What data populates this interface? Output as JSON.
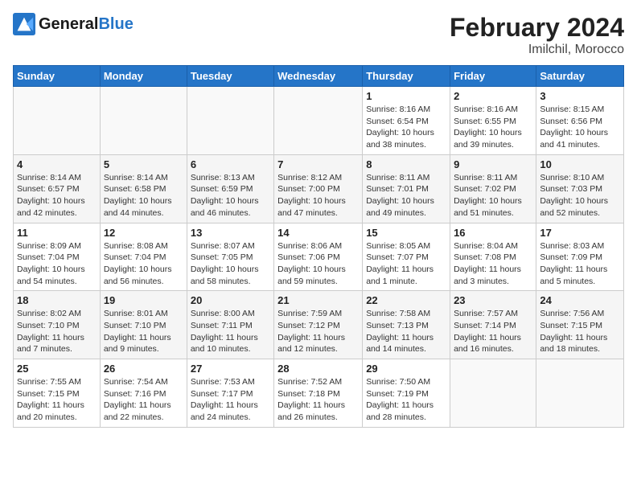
{
  "header": {
    "logo_general": "General",
    "logo_blue": "Blue",
    "month_year": "February 2024",
    "location": "Imilchil, Morocco"
  },
  "weekdays": [
    "Sunday",
    "Monday",
    "Tuesday",
    "Wednesday",
    "Thursday",
    "Friday",
    "Saturday"
  ],
  "weeks": [
    [
      {
        "day": "",
        "info": ""
      },
      {
        "day": "",
        "info": ""
      },
      {
        "day": "",
        "info": ""
      },
      {
        "day": "",
        "info": ""
      },
      {
        "day": "1",
        "info": "Sunrise: 8:16 AM\nSunset: 6:54 PM\nDaylight: 10 hours\nand 38 minutes."
      },
      {
        "day": "2",
        "info": "Sunrise: 8:16 AM\nSunset: 6:55 PM\nDaylight: 10 hours\nand 39 minutes."
      },
      {
        "day": "3",
        "info": "Sunrise: 8:15 AM\nSunset: 6:56 PM\nDaylight: 10 hours\nand 41 minutes."
      }
    ],
    [
      {
        "day": "4",
        "info": "Sunrise: 8:14 AM\nSunset: 6:57 PM\nDaylight: 10 hours\nand 42 minutes."
      },
      {
        "day": "5",
        "info": "Sunrise: 8:14 AM\nSunset: 6:58 PM\nDaylight: 10 hours\nand 44 minutes."
      },
      {
        "day": "6",
        "info": "Sunrise: 8:13 AM\nSunset: 6:59 PM\nDaylight: 10 hours\nand 46 minutes."
      },
      {
        "day": "7",
        "info": "Sunrise: 8:12 AM\nSunset: 7:00 PM\nDaylight: 10 hours\nand 47 minutes."
      },
      {
        "day": "8",
        "info": "Sunrise: 8:11 AM\nSunset: 7:01 PM\nDaylight: 10 hours\nand 49 minutes."
      },
      {
        "day": "9",
        "info": "Sunrise: 8:11 AM\nSunset: 7:02 PM\nDaylight: 10 hours\nand 51 minutes."
      },
      {
        "day": "10",
        "info": "Sunrise: 8:10 AM\nSunset: 7:03 PM\nDaylight: 10 hours\nand 52 minutes."
      }
    ],
    [
      {
        "day": "11",
        "info": "Sunrise: 8:09 AM\nSunset: 7:04 PM\nDaylight: 10 hours\nand 54 minutes."
      },
      {
        "day": "12",
        "info": "Sunrise: 8:08 AM\nSunset: 7:04 PM\nDaylight: 10 hours\nand 56 minutes."
      },
      {
        "day": "13",
        "info": "Sunrise: 8:07 AM\nSunset: 7:05 PM\nDaylight: 10 hours\nand 58 minutes."
      },
      {
        "day": "14",
        "info": "Sunrise: 8:06 AM\nSunset: 7:06 PM\nDaylight: 10 hours\nand 59 minutes."
      },
      {
        "day": "15",
        "info": "Sunrise: 8:05 AM\nSunset: 7:07 PM\nDaylight: 11 hours\nand 1 minute."
      },
      {
        "day": "16",
        "info": "Sunrise: 8:04 AM\nSunset: 7:08 PM\nDaylight: 11 hours\nand 3 minutes."
      },
      {
        "day": "17",
        "info": "Sunrise: 8:03 AM\nSunset: 7:09 PM\nDaylight: 11 hours\nand 5 minutes."
      }
    ],
    [
      {
        "day": "18",
        "info": "Sunrise: 8:02 AM\nSunset: 7:10 PM\nDaylight: 11 hours\nand 7 minutes."
      },
      {
        "day": "19",
        "info": "Sunrise: 8:01 AM\nSunset: 7:10 PM\nDaylight: 11 hours\nand 9 minutes."
      },
      {
        "day": "20",
        "info": "Sunrise: 8:00 AM\nSunset: 7:11 PM\nDaylight: 11 hours\nand 10 minutes."
      },
      {
        "day": "21",
        "info": "Sunrise: 7:59 AM\nSunset: 7:12 PM\nDaylight: 11 hours\nand 12 minutes."
      },
      {
        "day": "22",
        "info": "Sunrise: 7:58 AM\nSunset: 7:13 PM\nDaylight: 11 hours\nand 14 minutes."
      },
      {
        "day": "23",
        "info": "Sunrise: 7:57 AM\nSunset: 7:14 PM\nDaylight: 11 hours\nand 16 minutes."
      },
      {
        "day": "24",
        "info": "Sunrise: 7:56 AM\nSunset: 7:15 PM\nDaylight: 11 hours\nand 18 minutes."
      }
    ],
    [
      {
        "day": "25",
        "info": "Sunrise: 7:55 AM\nSunset: 7:15 PM\nDaylight: 11 hours\nand 20 minutes."
      },
      {
        "day": "26",
        "info": "Sunrise: 7:54 AM\nSunset: 7:16 PM\nDaylight: 11 hours\nand 22 minutes."
      },
      {
        "day": "27",
        "info": "Sunrise: 7:53 AM\nSunset: 7:17 PM\nDaylight: 11 hours\nand 24 minutes."
      },
      {
        "day": "28",
        "info": "Sunrise: 7:52 AM\nSunset: 7:18 PM\nDaylight: 11 hours\nand 26 minutes."
      },
      {
        "day": "29",
        "info": "Sunrise: 7:50 AM\nSunset: 7:19 PM\nDaylight: 11 hours\nand 28 minutes."
      },
      {
        "day": "",
        "info": ""
      },
      {
        "day": "",
        "info": ""
      }
    ]
  ]
}
